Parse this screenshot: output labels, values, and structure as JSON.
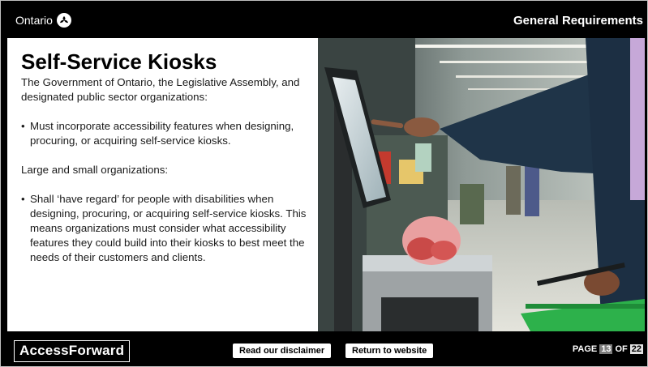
{
  "header": {
    "brand": "Ontario",
    "section_title": "General Requirements"
  },
  "content": {
    "title": "Self-Service Kiosks",
    "intro1": "The Government of Ontario, the Legislative Assembly, and designated public sector organizations:",
    "bullet1": "Must incorporate accessibility features when designing, procuring, or acquiring self-service kiosks.",
    "intro2": "Large and small organizations:",
    "bullet2": "Shall ‘have regard’ for people with disabilities when designing, procuring, or acquiring self-service kiosks. This means organizations must consider what accessibility features they could build into their kiosks to best meet the needs of their customers and clients."
  },
  "footer": {
    "logo": "AccessForward",
    "disclaimer_label": "Read our disclaimer",
    "website_label": "Return to website",
    "page_label": "PAGE",
    "page_current": "13",
    "of_label": "OF",
    "page_total": "22"
  },
  "colors": {
    "background": "#000000",
    "panel": "#ffffff",
    "basket": "#2db14b"
  }
}
